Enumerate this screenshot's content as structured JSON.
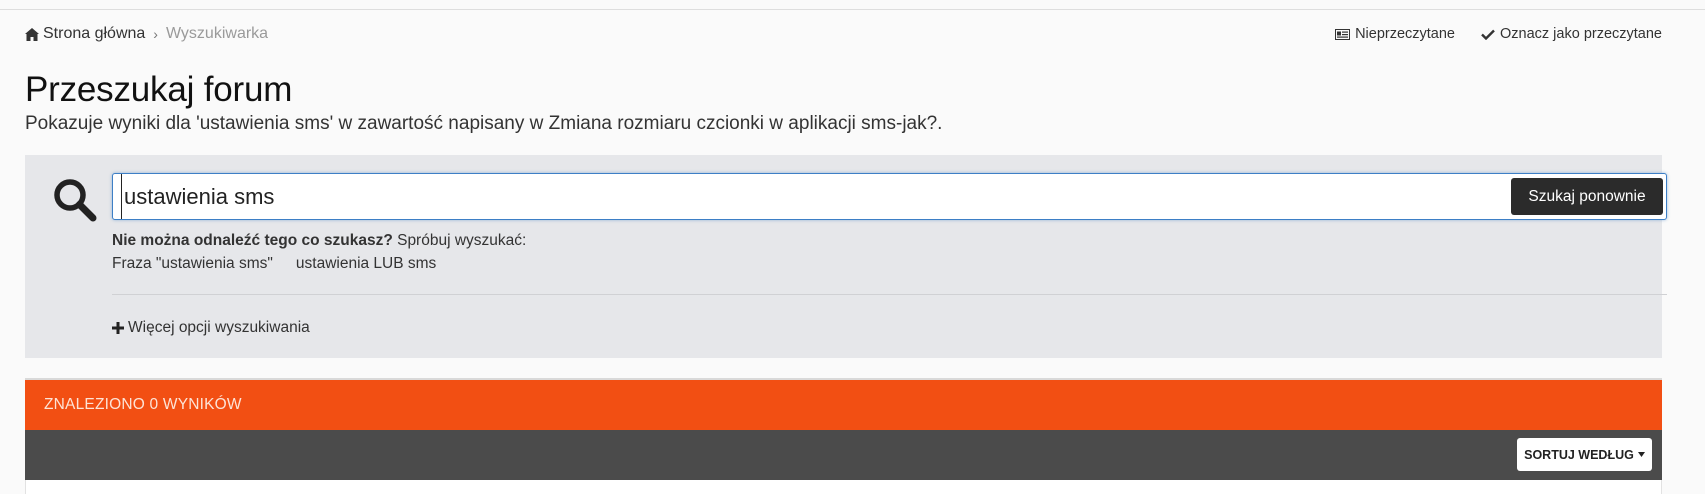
{
  "breadcrumb": {
    "home_icon": "home-icon",
    "home_label": "Strona główna",
    "separator": "›",
    "current": "Wyszukiwarka"
  },
  "top_actions": {
    "unread_icon": "newspaper-icon",
    "unread_label": "Nieprzeczytane",
    "mark_read_icon": "check-icon",
    "mark_read_label": "Oznacz jako przeczytane"
  },
  "page": {
    "title": "Przeszukaj forum",
    "subtitle": "Pokazuje wyniki dla 'ustawienia sms' w zawartość napisany w Zmiana rozmiaru czcionki w aplikacji sms-jak?."
  },
  "search": {
    "icon": "search-icon",
    "value": "ustawienia sms",
    "button_label": "Szukaj ponownie",
    "not_found_bold": "Nie można odnaleźć tego co szukasz?",
    "not_found_text": " Spróbuj wyszukać:",
    "suggestions": [
      "Fraza \"ustawienia sms\"",
      "ustawienia LUB sms"
    ],
    "more_options_icon": "plus-icon",
    "more_options_label": "Więcej opcji wyszukiwania"
  },
  "results": {
    "header": "ZNALEZIONO 0 WYNIKÓW",
    "sort_label": "SORTUJ WEDŁUG",
    "sort_icon": "caret-down-icon"
  },
  "colors": {
    "accent": "#f24f13",
    "toolbar": "#4b4b4b",
    "panel": "#e6e7ea",
    "button_dark": "#2b2b2b",
    "focus_border": "#3d7fc6"
  }
}
